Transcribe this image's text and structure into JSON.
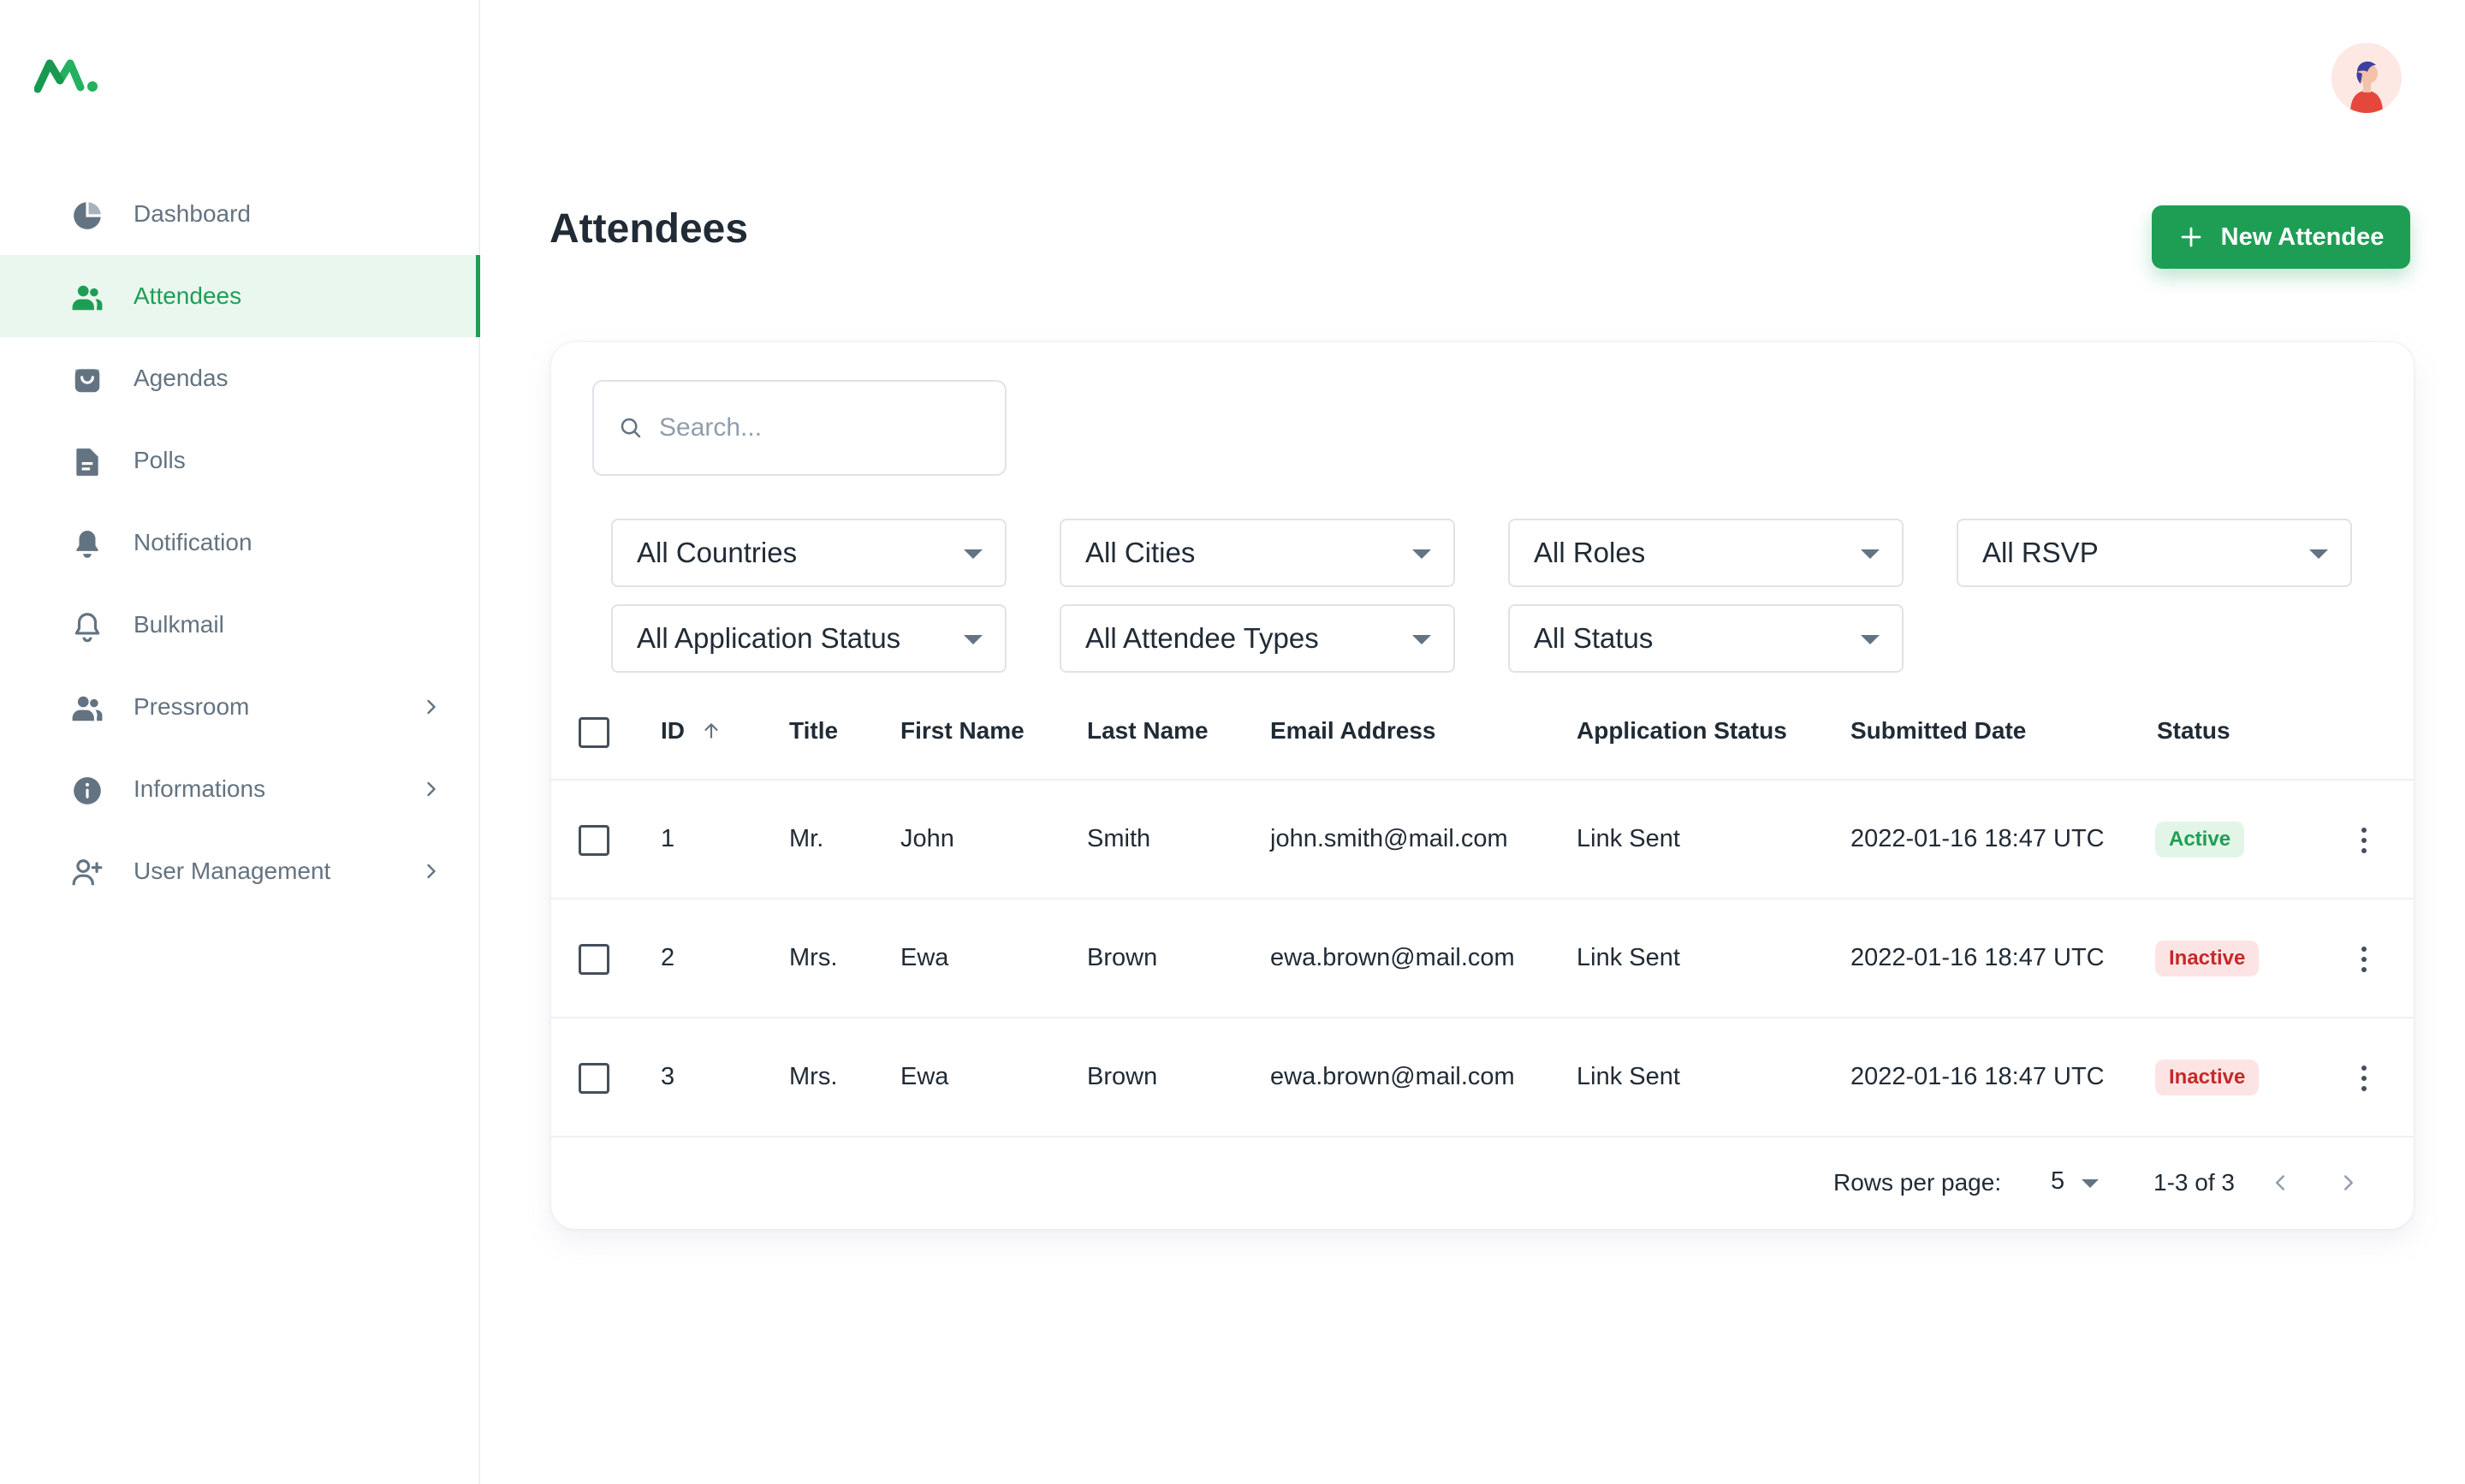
{
  "colors": {
    "accent": "#1e9e55",
    "active_bg": "#eaf7ef",
    "danger": "#c62828"
  },
  "sidebar": {
    "logo_icon": "m-logo",
    "items": [
      {
        "label": "Dashboard",
        "icon": "pie-chart-icon",
        "active": false,
        "has_submenu": false
      },
      {
        "label": "Attendees",
        "icon": "people-icon",
        "active": true,
        "has_submenu": false
      },
      {
        "label": "Agendas",
        "icon": "bag-icon",
        "active": false,
        "has_submenu": false
      },
      {
        "label": "Polls",
        "icon": "document-icon",
        "active": false,
        "has_submenu": false
      },
      {
        "label": "Notification",
        "icon": "bell-filled-icon",
        "active": false,
        "has_submenu": false
      },
      {
        "label": "Bulkmail",
        "icon": "bell-outline-icon",
        "active": false,
        "has_submenu": false
      },
      {
        "label": "Pressroom",
        "icon": "people-icon",
        "active": false,
        "has_submenu": true
      },
      {
        "label": "Informations",
        "icon": "info-icon",
        "active": false,
        "has_submenu": true
      },
      {
        "label": "User Management",
        "icon": "person-add-icon",
        "active": false,
        "has_submenu": true
      }
    ]
  },
  "header": {
    "title": "Attendees",
    "new_button_label": "New Attendee"
  },
  "search": {
    "placeholder": "Search...",
    "value": ""
  },
  "filters": [
    {
      "selected": "All Countries"
    },
    {
      "selected": "All Cities"
    },
    {
      "selected": "All Roles"
    },
    {
      "selected": "All RSVP"
    },
    {
      "selected": "All Application Status"
    },
    {
      "selected": "All Attendee Types"
    },
    {
      "selected": "All Status"
    }
  ],
  "table": {
    "columns": [
      "ID",
      "Title",
      "First Name",
      "Last Name",
      "Email Address",
      "Application Status",
      "Submitted Date",
      "Status"
    ],
    "sort": {
      "column": "ID",
      "direction": "asc"
    },
    "rows": [
      {
        "id": "1",
        "title": "Mr.",
        "first_name": "John",
        "last_name": "Smith",
        "email": "john.smith@mail.com",
        "application_status": "Link Sent",
        "submitted": "2022-01-16 18:47 UTC",
        "status": "Active"
      },
      {
        "id": "2",
        "title": "Mrs.",
        "first_name": "Ewa",
        "last_name": "Brown",
        "email": "ewa.brown@mail.com",
        "application_status": "Link Sent",
        "submitted": "2022-01-16 18:47 UTC",
        "status": "Inactive"
      },
      {
        "id": "3",
        "title": "Mrs.",
        "first_name": "Ewa",
        "last_name": "Brown",
        "email": "ewa.brown@mail.com",
        "application_status": "Link Sent",
        "submitted": "2022-01-16 18:47 UTC",
        "status": "Inactive"
      }
    ]
  },
  "pagination": {
    "rows_per_page_label": "Rows per page:",
    "rows_per_page": "5",
    "range": "1-3 of 3"
  }
}
